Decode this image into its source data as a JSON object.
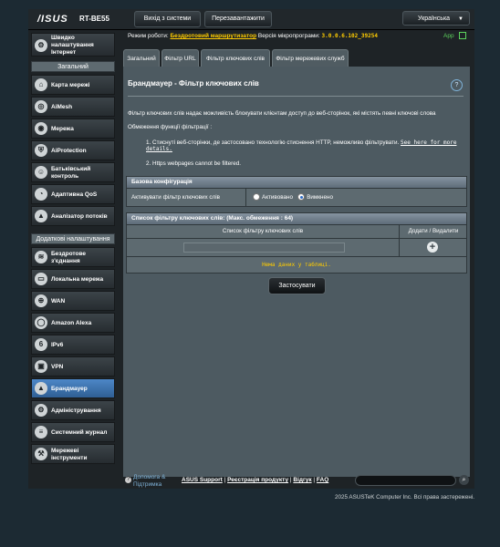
{
  "header": {
    "brand": "/ISUS",
    "model": "RT-BE55",
    "logout_label": "Вихід з системи",
    "reboot_label": "Перезавантажити",
    "language": "Українська"
  },
  "status": {
    "mode_label": "Режим роботи:",
    "mode_value": "Бездротовий маршрутизатор",
    "firmware_label": "Версія мікропрограми:",
    "firmware_value": "3.0.0.6.102_39254",
    "app_label": "App"
  },
  "sidebar": {
    "quick_setup": "Швидко налаштування Інтернет",
    "general_header": "Загальний",
    "general_items": [
      {
        "label": "Карта мережі",
        "icon": "network-map-icon"
      },
      {
        "label": "AiMesh",
        "icon": "aimesh-icon"
      },
      {
        "label": "Мережа",
        "icon": "network-icon"
      },
      {
        "label": "AiProtection",
        "icon": "aiprotection-icon"
      },
      {
        "label": "Батьківський контроль",
        "icon": "parental-control-icon"
      },
      {
        "label": "Адаптивна QoS",
        "icon": "qos-icon"
      },
      {
        "label": "Аналізатор потоків",
        "icon": "traffic-analyzer-icon"
      }
    ],
    "advanced_header": "Додаткові налаштування",
    "advanced_items": [
      {
        "label": "Бездротове з'єднання",
        "icon": "wireless-icon"
      },
      {
        "label": "Локальна мережа",
        "icon": "lan-icon"
      },
      {
        "label": "WAN",
        "icon": "wan-icon"
      },
      {
        "label": "Amazon Alexa",
        "icon": "alexa-icon"
      },
      {
        "label": "IPv6",
        "icon": "ipv6-icon"
      },
      {
        "label": "VPN",
        "icon": "vpn-icon"
      },
      {
        "label": "Брандмауер",
        "icon": "firewall-icon"
      },
      {
        "label": "Адміністрування",
        "icon": "administration-icon"
      },
      {
        "label": "Системний журнал",
        "icon": "system-log-icon"
      },
      {
        "label": "Мережеві інструменти",
        "icon": "network-tools-icon"
      }
    ]
  },
  "tabs": [
    {
      "label": "Загальний"
    },
    {
      "label": "Фільтр URL"
    },
    {
      "label": "Фільтр ключових слів"
    },
    {
      "label": "Фільтр мережевих служб"
    }
  ],
  "page": {
    "title": "Брандмауер - Фільтр ключових слів",
    "description": "Фільтр ключових слів надає можливість блокувати клієнтам доступ до веб-сторінок, які містять певні ключові слова",
    "limits_title": "Обмеження функції фільтрації :",
    "limit1_text": "Стиснуті веб-сторінки, де застосовано технологію стиснення HTTP, неможливо фільтрувати.",
    "limit1_link": "See here for more details.",
    "limit2_text": "Https webpages cannot be filtered."
  },
  "basic_config": {
    "header": "Базова конфігурація",
    "enable_label": "Активувати фільтр ключових слів",
    "option_on": "Активовано",
    "option_off": "Вимкнено",
    "selected": "off"
  },
  "keyword_list": {
    "header": "Список фільтру ключових слів: (Макс. обмеження : 64)",
    "col_list": "Список фільтру ключових слів",
    "col_action": "Додати / Видалити",
    "input_value": "",
    "empty_text": "Нема даних у таблиці."
  },
  "apply_label": "Застосувати",
  "footer": {
    "help_label": "Допомога & Підтримка",
    "links": [
      "ASUS Support",
      "Реєстрація продукту",
      "Відгук",
      "FAQ"
    ],
    "copyright": "2025 ASUSTeK Computer Inc. Всі права застережені."
  }
}
